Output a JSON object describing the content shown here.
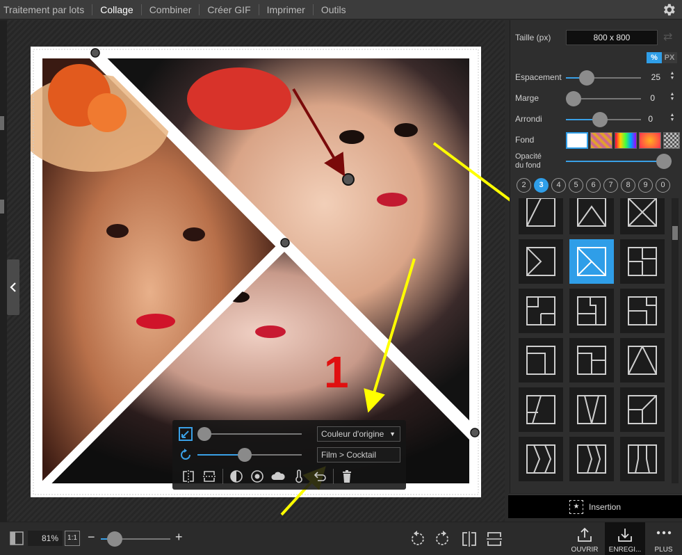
{
  "menu": {
    "items": [
      "Traitement par lots",
      "Collage",
      "Combiner",
      "Créer GIF",
      "Imprimer",
      "Outils"
    ],
    "active_index": 1
  },
  "canvas": {
    "annotation_number": "1",
    "photo_toolbar": {
      "filter_select": "Couleur d'origine",
      "effect_field": "Film > Cocktail",
      "zoom_level": 0.05,
      "rotate_level": 0.45
    }
  },
  "panel": {
    "size_label": "Taille (px)",
    "size_value": "800 x 800",
    "unit_percent": "%",
    "unit_px": "PX",
    "spacing": {
      "label": "Espacement",
      "value": "25",
      "level": 0.28
    },
    "margin": {
      "label": "Marge",
      "value": "0",
      "level": 0.0
    },
    "rounding": {
      "label": "Arrondi",
      "value": "0",
      "level": 0.45
    },
    "background": {
      "label": "Fond",
      "swatches": [
        "white",
        "pattern",
        "rainbow",
        "gradient",
        "transparent"
      ]
    },
    "opacity": {
      "label_line1": "Opacité",
      "label_line2": "du fond",
      "level": 1.0
    },
    "counts": [
      "2",
      "3",
      "4",
      "5",
      "6",
      "7",
      "8",
      "9",
      "0"
    ],
    "active_count": "3",
    "selected_layout_index": 4,
    "insert_label": "Insertion"
  },
  "bottom": {
    "zoom_value": "81%",
    "zoom_one": "1:1",
    "zoom_level": 0.2,
    "open_label": "OUVRIR",
    "save_label": "ENREGI...",
    "more_label": "PLUS"
  },
  "colors": {
    "accent": "#2f9ee8",
    "arrow_yellow": "#ffff00",
    "arrow_dark_red": "#7a0a0a",
    "number_red": "#e01010"
  },
  "icons": [
    "gear-icon",
    "chevron-left-icon",
    "resize-icon",
    "rotate-icon",
    "flip-horizontal-icon",
    "flip-vertical-icon",
    "contrast-icon",
    "brightness-icon",
    "cloud-icon",
    "temperature-icon",
    "undo-icon",
    "trash-icon",
    "insert-icon",
    "open-icon",
    "save-icon",
    "more-icon",
    "rotate-left-icon",
    "rotate-right-icon",
    "swap-icon"
  ]
}
